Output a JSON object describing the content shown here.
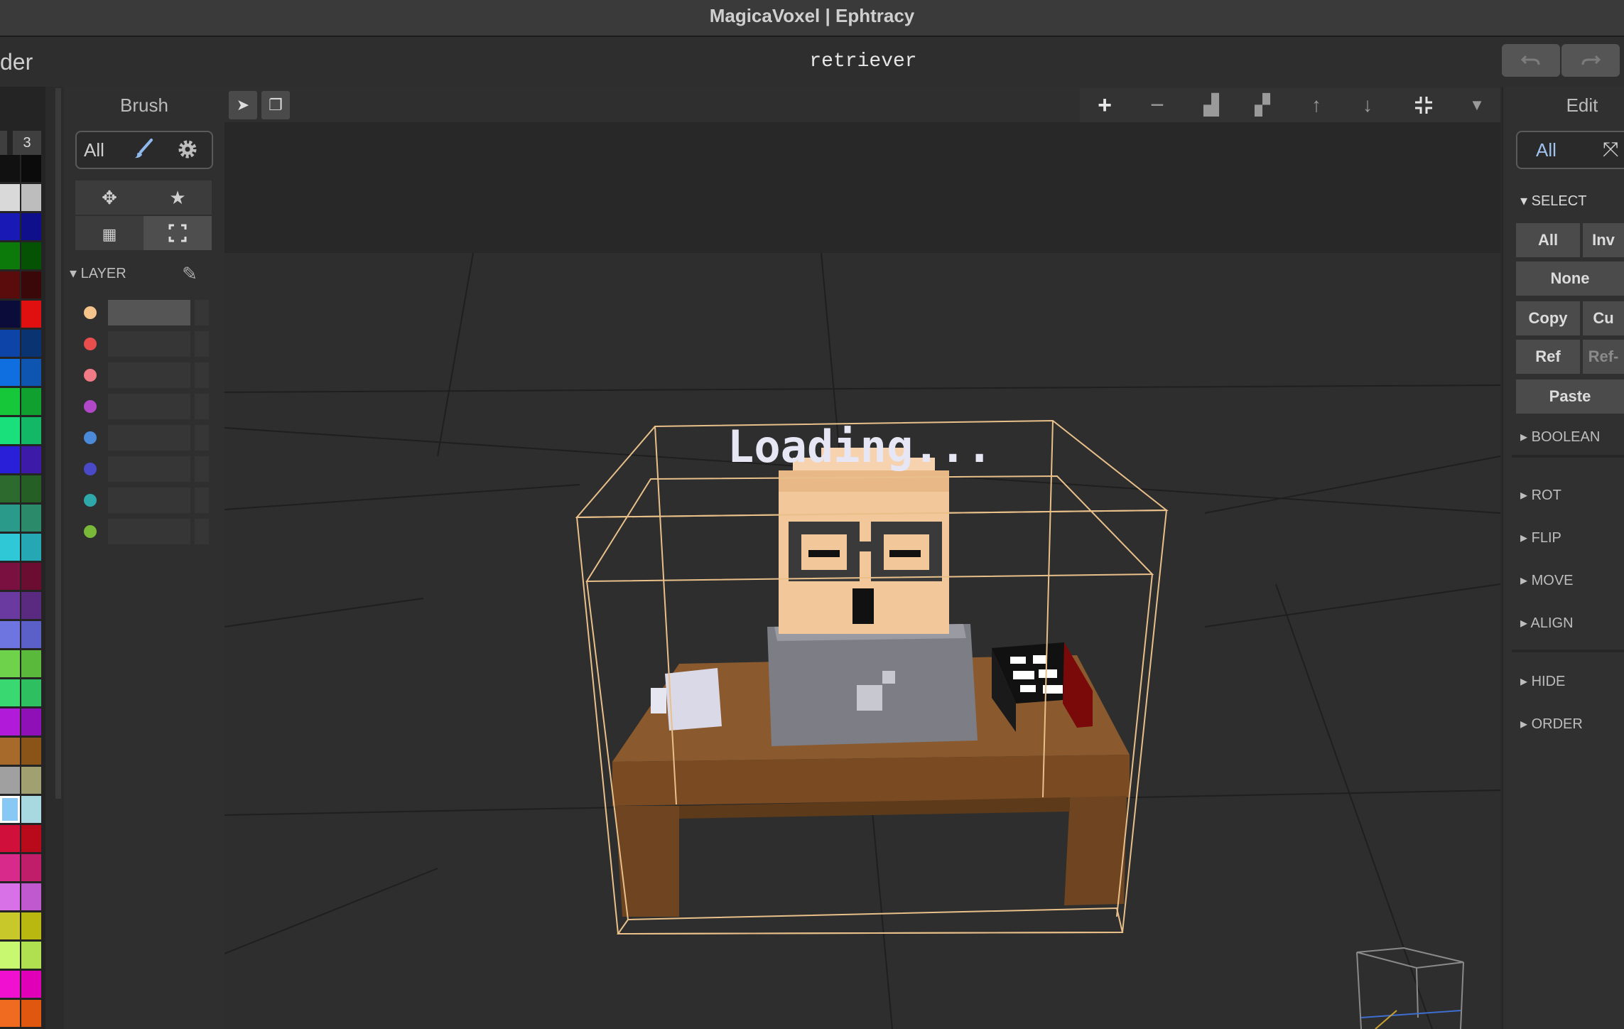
{
  "app": {
    "title": "MagicaVoxel | Ephtracy"
  },
  "document": {
    "name": "retriever",
    "left_clipped_label": "der"
  },
  "history": {
    "undo_icon": "undo-icon",
    "redo_icon": "redo-icon"
  },
  "palette": {
    "tab_label": "3",
    "colors": [
      [
        "#111111",
        "#0b0b0b"
      ],
      [
        "#d9d9d9",
        "#bdbdbd"
      ],
      [
        "#1919b6",
        "#0f0f8c"
      ],
      [
        "#0b7a0b",
        "#055205"
      ],
      [
        "#5a0c0c",
        "#3a0808"
      ],
      [
        "#0c0c3a",
        "#e01010"
      ],
      [
        "#0d44a8",
        "#0a3372"
      ],
      [
        "#0f6fe0",
        "#0e55b2"
      ],
      [
        "#17c73a",
        "#10a030"
      ],
      [
        "#19e07a",
        "#12b865"
      ],
      [
        "#2a1fd8",
        "#3d1aa8"
      ],
      [
        "#2d6a2d",
        "#255f25"
      ],
      [
        "#2a9a8a",
        "#2a8a6a"
      ],
      [
        "#2ec8d6",
        "#25a8b4"
      ],
      [
        "#7a1040",
        "#6a0d30"
      ],
      [
        "#6a3aa0",
        "#5a2a80"
      ],
      [
        "#6e74e0",
        "#5a60c8"
      ],
      [
        "#6ed24a",
        "#5ab83a"
      ],
      [
        "#3ad870",
        "#2ec060"
      ],
      [
        "#b01ad8",
        "#9010b8"
      ],
      [
        "#a86a2a",
        "#8a5418"
      ],
      [
        "#a0a0a0",
        "#a0a070"
      ],
      [
        "#88c8f4",
        "#a8d8e0"
      ],
      [
        "#d0103a",
        "#b80a1a"
      ],
      [
        "#d82a8a",
        "#c01e6a"
      ],
      [
        "#d870e8",
        "#c058d0"
      ],
      [
        "#c8c82a",
        "#b8b810"
      ],
      [
        "#c8f870",
        "#b0e050"
      ],
      [
        "#f010d0",
        "#e000b8"
      ],
      [
        "#f06a20",
        "#e05810"
      ]
    ]
  },
  "brush_panel": {
    "title": "Brush",
    "mode_label": "All",
    "tools": [
      "move-icon",
      "star-icon",
      "grid-icon",
      "frame-icon"
    ],
    "layer_header": "LAYER",
    "layers": [
      {
        "color": "#f5c38c",
        "selected": true
      },
      {
        "color": "#e94e4e",
        "selected": false
      },
      {
        "color": "#f07a86",
        "selected": false
      },
      {
        "color": "#b048c8",
        "selected": false
      },
      {
        "color": "#4a8ad8",
        "selected": false
      },
      {
        "color": "#4a4ac8",
        "selected": false
      },
      {
        "color": "#2ea8a8",
        "selected": false
      },
      {
        "color": "#7ab83a",
        "selected": false
      }
    ]
  },
  "viewport": {
    "toolbar_left": [
      "cursor-icon",
      "copy-icon"
    ],
    "toolbar_right": [
      "plus-icon",
      "minus-icon",
      "shrink-corner-icon",
      "expand-corner-icon",
      "arrow-up-icon",
      "arrow-down-icon",
      "compress-icon",
      "dropdown-icon"
    ],
    "scene_text": "Loading..."
  },
  "edit_panel": {
    "title": "Edit",
    "mode_label": "All",
    "select_header": "SELECT",
    "buttons": {
      "all": "All",
      "invert": "Inv",
      "none": "None",
      "copy": "Copy",
      "cut": "Cu",
      "ref": "Ref",
      "ref_minus": "Ref-",
      "paste": "Paste"
    },
    "sections": [
      "BOOLEAN",
      "ROT",
      "FLIP",
      "MOVE",
      "ALIGN",
      "HIDE",
      "ORDER"
    ]
  }
}
